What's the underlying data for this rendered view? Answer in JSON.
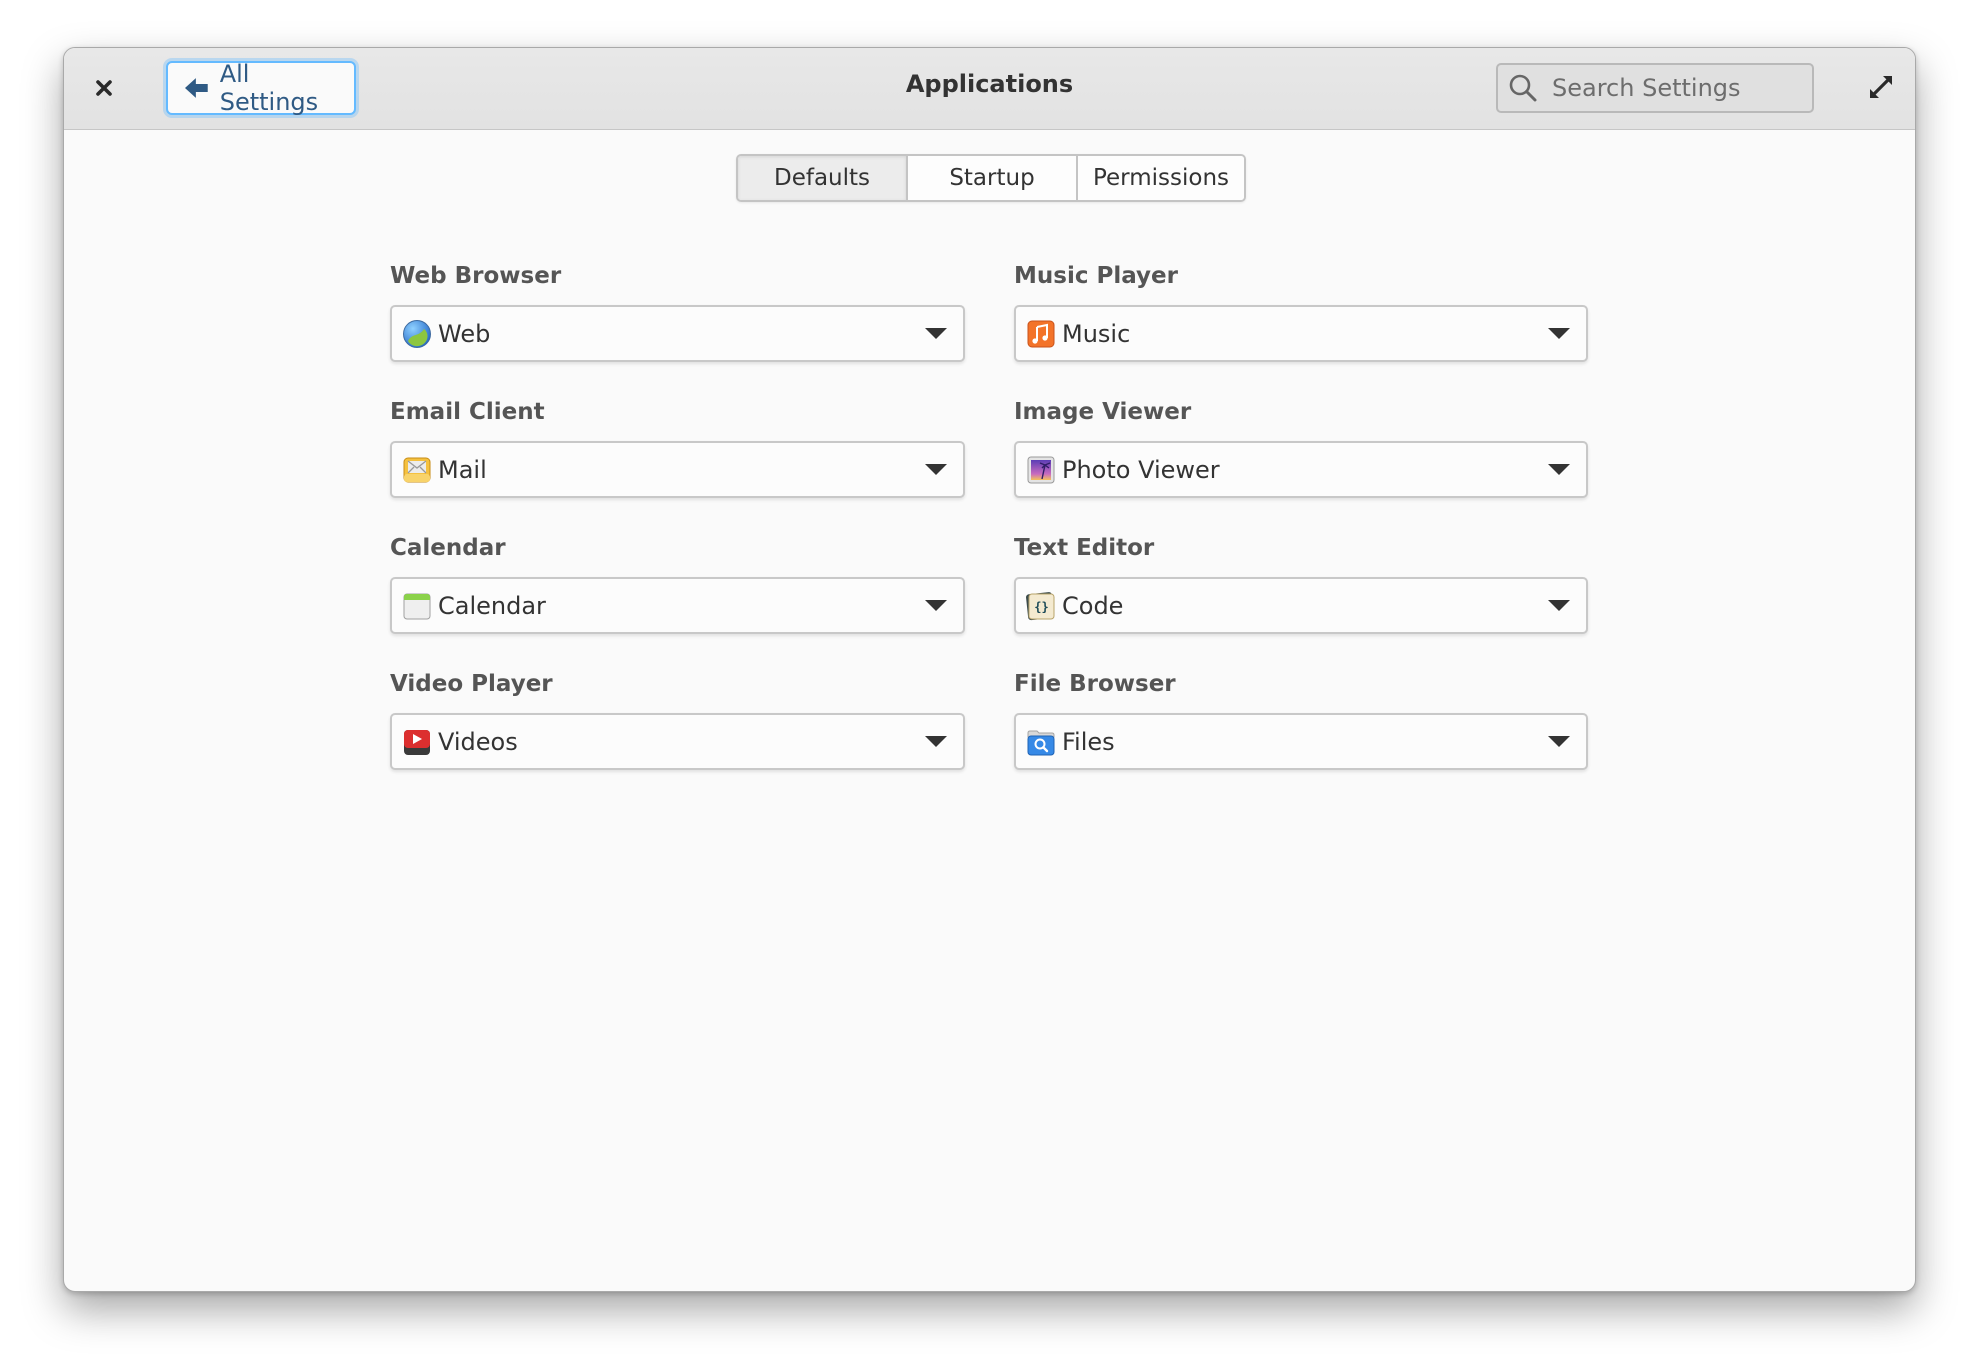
{
  "header": {
    "close_icon": "close-icon",
    "back_button_label": "All Settings",
    "back_icon": "arrow-left-icon",
    "title": "Applications",
    "search_placeholder": "Search Settings",
    "search_value": "",
    "search_icon": "search-icon",
    "expand_icon": "maximize-icon"
  },
  "tabs": [
    {
      "label": "Defaults",
      "active": true
    },
    {
      "label": "Startup",
      "active": false
    },
    {
      "label": "Permissions",
      "active": false
    }
  ],
  "defaults": {
    "left": [
      {
        "label": "Web Browser",
        "value": "Web",
        "icon": "web-browser-globe-icon"
      },
      {
        "label": "Email Client",
        "value": "Mail",
        "icon": "mail-icon"
      },
      {
        "label": "Calendar",
        "value": "Calendar",
        "icon": "calendar-icon"
      },
      {
        "label": "Video Player",
        "value": "Videos",
        "icon": "videos-icon"
      }
    ],
    "right": [
      {
        "label": "Music Player",
        "value": "Music",
        "icon": "music-icon"
      },
      {
        "label": "Image Viewer",
        "value": "Photo Viewer",
        "icon": "photo-viewer-icon"
      },
      {
        "label": "Text Editor",
        "value": "Code",
        "icon": "code-icon"
      },
      {
        "label": "File Browser",
        "value": "Files",
        "icon": "files-icon"
      }
    ]
  },
  "colors": {
    "accent": "#64baff",
    "back_text": "#2f5a84",
    "header_bg": "#e5e5e5",
    "content_bg": "#fafafa"
  }
}
